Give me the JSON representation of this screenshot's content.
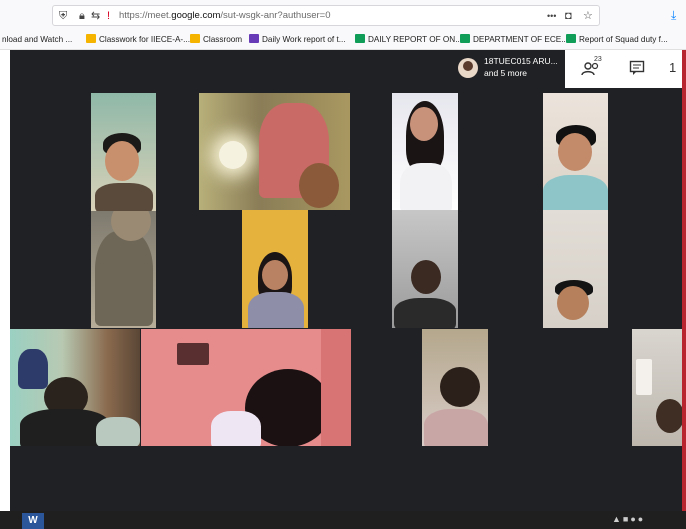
{
  "browser": {
    "url_prefix": "https://meet.",
    "url_domain": "google.com",
    "url_path": "/sut-wsgk-anr?authuser=0",
    "more_glyph": "•••",
    "icons": [
      "shield-icon",
      "lock-icon",
      "permissions-icon",
      "pocket-icon",
      "star-icon",
      "download-icon"
    ]
  },
  "bookmarks": [
    {
      "label": "nload and Watch ...",
      "color": "#ffffff"
    },
    {
      "label": "Classwork for IIECE-A-...",
      "color": "#f4b400"
    },
    {
      "label": "Classroom",
      "color": "#f4b400"
    },
    {
      "label": "Daily Work report of t...",
      "color": "#673ab7"
    },
    {
      "label": "DAILY REPORT OF ON...",
      "color": "#0f9d58"
    },
    {
      "label": "DEPARTMENT OF ECE...",
      "color": "#0f9d58"
    },
    {
      "label": "Report of Squad duty f...",
      "color": "#0f9d58"
    }
  ],
  "meet": {
    "presenter_name": "18TUEC015 ARU...",
    "presenter_more": "and 5 more",
    "people_count": "23",
    "overflow_label": "1"
  },
  "colors": {
    "meet_bg": "#202124",
    "accent_red": "#b8252e"
  }
}
